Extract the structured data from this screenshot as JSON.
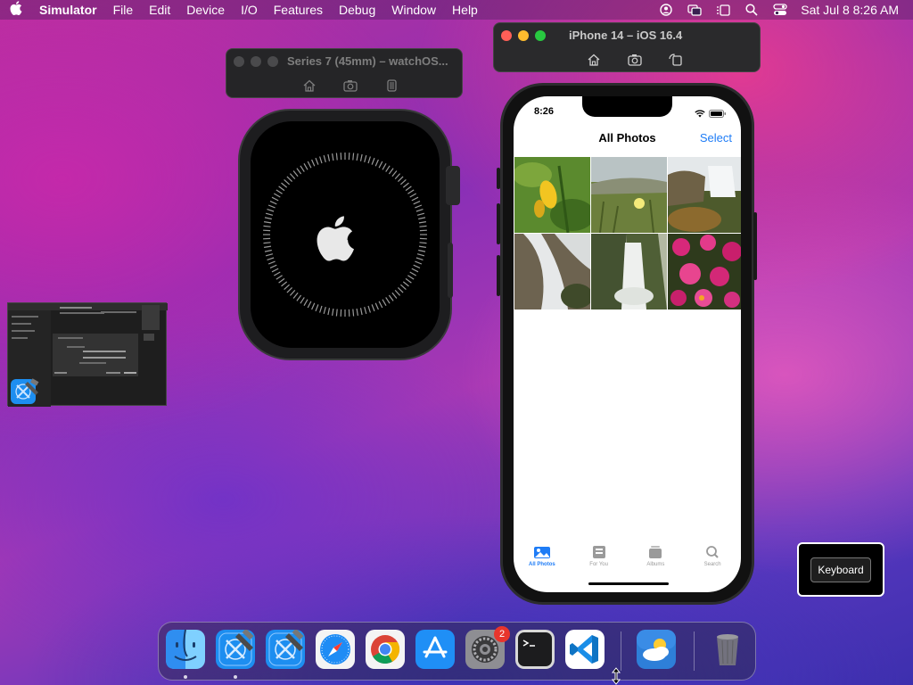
{
  "menubar": {
    "app_name": "Simulator",
    "items": [
      "File",
      "Edit",
      "Device",
      "I/O",
      "Features",
      "Debug",
      "Window",
      "Help"
    ],
    "clock": "Sat Jul 8  8:26 AM",
    "status_icons": [
      "user-icon",
      "screen-mirror-icon",
      "stage-manager-icon",
      "search-icon",
      "control-center-icon"
    ]
  },
  "watch_window": {
    "title": "Series 7 (45mm) – watchOS...",
    "toolbar": [
      "home-icon",
      "screenshot-icon",
      "rotate-icon"
    ]
  },
  "phone_window": {
    "title": "iPhone 14 – iOS 16.4",
    "toolbar": [
      "home-icon",
      "screenshot-icon",
      "rotate-icon"
    ]
  },
  "phone": {
    "status_time": "8:26",
    "nav_title": "All Photos",
    "select_label": "Select",
    "photos": [
      "yellow-flower-photo",
      "field-flowers-photo",
      "waterfall-photo",
      "cascade-photo",
      "misty-waterfall-photo",
      "pink-flowers-photo"
    ],
    "tabs": [
      {
        "label": "All Photos",
        "icon": "photos-icon",
        "active": true
      },
      {
        "label": "For You",
        "icon": "for-you-icon",
        "active": false
      },
      {
        "label": "Albums",
        "icon": "albums-icon",
        "active": false
      },
      {
        "label": "Search",
        "icon": "search-icon",
        "active": false
      }
    ]
  },
  "keyboard_popover": {
    "button_label": "Keyboard"
  },
  "dock": {
    "apps": [
      "Finder",
      "Xcode",
      "Xcode",
      "Safari",
      "Chrome",
      "App Store",
      "System Settings",
      "Terminal",
      "VS Code",
      "Weather",
      "Trash"
    ],
    "settings_badge": "2"
  },
  "colors": {
    "accent": "#1e7cf6",
    "badge": "#e8352c"
  }
}
